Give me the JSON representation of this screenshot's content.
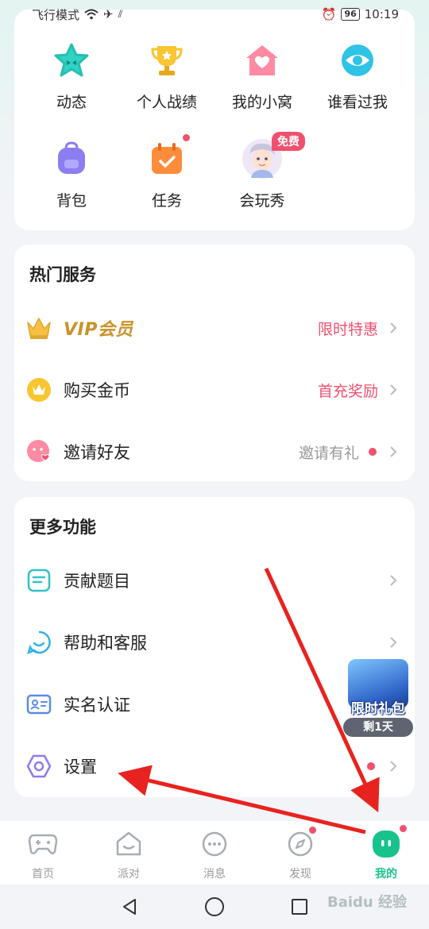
{
  "status_bar": {
    "left_text": "飞行模式",
    "battery": "96",
    "time": "10:19"
  },
  "grid": {
    "items": [
      {
        "label": "动态",
        "icon": "star-face-icon"
      },
      {
        "label": "个人战绩",
        "icon": "trophy-icon"
      },
      {
        "label": "我的小窝",
        "icon": "house-heart-icon"
      },
      {
        "label": "谁看过我",
        "icon": "eye-icon"
      },
      {
        "label": "背包",
        "icon": "backpack-icon"
      },
      {
        "label": "任务",
        "icon": "calendar-check-icon"
      },
      {
        "label": "会玩秀",
        "icon": "avatar-icon",
        "tag": "免费"
      }
    ]
  },
  "hot_services": {
    "title": "热门服务",
    "items": [
      {
        "label": "VIP会员",
        "right": "限时特惠",
        "right_color": "#f0506e"
      },
      {
        "label": "购买金币",
        "right": "首充奖励",
        "right_color": "#f0506e"
      },
      {
        "label": "邀请好友",
        "right": "邀请有礼",
        "right_color": "#999999"
      }
    ]
  },
  "more_features": {
    "title": "更多功能",
    "items": [
      {
        "label": "贡献题目",
        "icon": "document-icon"
      },
      {
        "label": "帮助和客服",
        "icon": "chat-smile-icon"
      },
      {
        "label": "实名认证",
        "icon": "id-card-icon"
      },
      {
        "label": "设置",
        "icon": "hexagon-settings-icon"
      }
    ]
  },
  "gift": {
    "title": "限时礼包",
    "remain": "剩1天"
  },
  "tabbar": {
    "tabs": [
      {
        "label": "首页",
        "icon": "gamepad-icon"
      },
      {
        "label": "派对",
        "icon": "party-house-icon"
      },
      {
        "label": "消息",
        "icon": "message-icon"
      },
      {
        "label": "发现",
        "icon": "compass-icon"
      },
      {
        "label": "我的",
        "icon": "me-icon",
        "active": true
      }
    ]
  },
  "watermark": "Baidu 经验",
  "colors": {
    "accent": "#18c28c",
    "badge": "#f0506e",
    "arrow": "#e8231f"
  }
}
